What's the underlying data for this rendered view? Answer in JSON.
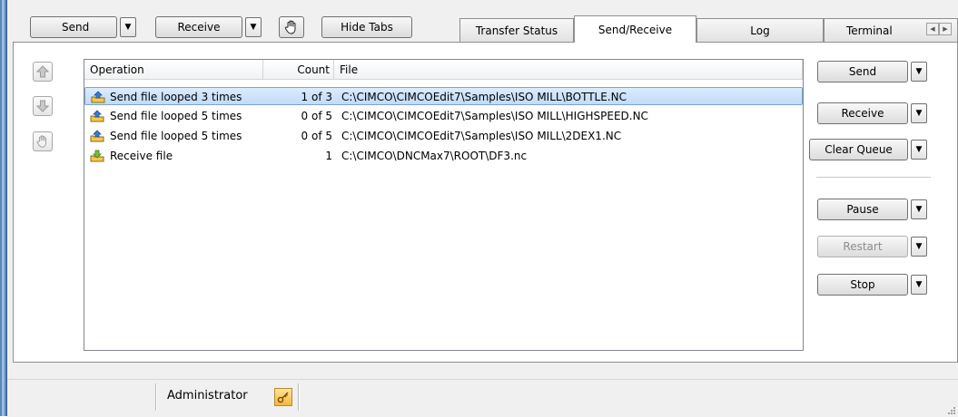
{
  "toolbar": {
    "send_label": "Send",
    "receive_label": "Receive",
    "hide_tabs_label": "Hide Tabs"
  },
  "tabs": [
    {
      "label": "Transfer Status"
    },
    {
      "label": "Send/Receive",
      "active": true
    },
    {
      "label": "Log"
    },
    {
      "label": "Terminal"
    }
  ],
  "queue": {
    "columns": {
      "operation": "Operation",
      "count": "Count",
      "file": "File"
    },
    "rows": [
      {
        "operation": "Send file looped 3 times",
        "count": "1 of 3",
        "file": "C:\\CIMCO\\CIMCOEdit7\\Samples\\ISO MILL\\BOTTLE.NC",
        "selected": true,
        "kind": "send"
      },
      {
        "operation": "Send file looped 5 times",
        "count": "0 of 5",
        "file": "C:\\CIMCO\\CIMCOEdit7\\Samples\\ISO MILL\\HIGHSPEED.NC",
        "kind": "send"
      },
      {
        "operation": "Send file looped 5 times",
        "count": "0 of 5",
        "file": "C:\\CIMCO\\CIMCOEdit7\\Samples\\ISO MILL\\2DEX1.NC",
        "kind": "send"
      },
      {
        "operation": "Receive file",
        "count": "1",
        "file": "C:\\CIMCO\\DNCMax7\\ROOT\\DF3.nc",
        "kind": "receive"
      }
    ]
  },
  "actions": {
    "send_label": "Send",
    "receive_label": "Receive",
    "clear_queue_label": "Clear Queue",
    "pause_label": "Pause",
    "restart_label": "Restart",
    "stop_label": "Stop"
  },
  "status": {
    "user": "Administrator"
  },
  "colors": {
    "selection": "#c1dbfc",
    "frame": "#5a89b8",
    "icon_send": "#f2c94c",
    "icon_receive": "#7dbb3c"
  },
  "icons": [
    "hand-icon",
    "arrow-up-icon",
    "arrow-down-icon",
    "send-file-icon",
    "receive-file-icon",
    "key-icon",
    "dropdown-arrow-icon"
  ]
}
